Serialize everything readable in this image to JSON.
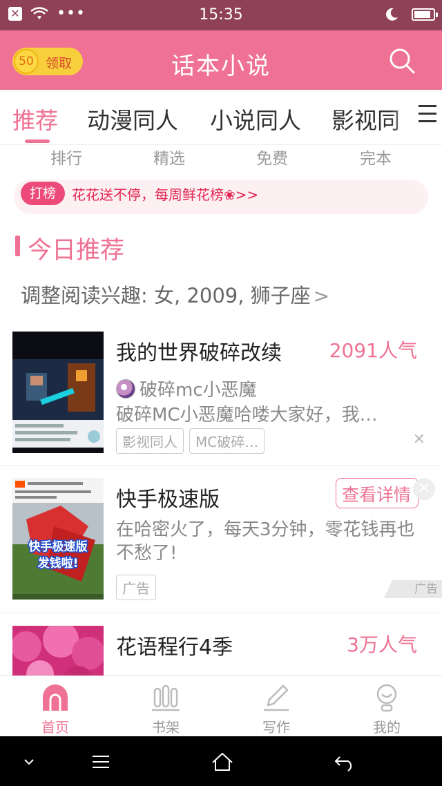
{
  "status_bar": {
    "time": "15:35",
    "battery_level": 0.9
  },
  "header": {
    "coin_value": "50",
    "claim_label": "领取",
    "title": "话本小说"
  },
  "category_tabs": [
    "推荐",
    "动漫同人",
    "小说同人",
    "影视同"
  ],
  "sub_tabs": [
    "排行",
    "精选",
    "免费",
    "完本"
  ],
  "banner": {
    "badge": "打榜",
    "text": "花花送不停，每周鲜花榜❀>>"
  },
  "section": {
    "title": "今日推荐",
    "interest": "调整阅读兴趣: 女, 2009, 狮子座",
    "chevron": ">"
  },
  "feed": [
    {
      "title": "我的世界破碎改续",
      "popularity": "2091人气",
      "author": "破碎mc小恶魔",
      "desc": "破碎MC小恶魔哈喽大家好，我…",
      "tags": [
        "影视同人",
        "MC破碎…"
      ],
      "close": "✕"
    },
    {
      "title": "快手极速版",
      "detail_button": "查看详情",
      "desc": "在哈密火了，每天3分钟，零花钱再也不愁了!",
      "tag": "广告",
      "ad_mark": "广告",
      "thumb_caption": "快手极速版\n发钱啦!"
    },
    {
      "title": "花语程行4季",
      "popularity": "3万人气"
    }
  ],
  "bottom_nav": [
    {
      "label": "首页",
      "icon": "home-icon",
      "active": true
    },
    {
      "label": "书架",
      "icon": "bookshelf-icon",
      "active": false
    },
    {
      "label": "写作",
      "icon": "pencil-icon",
      "active": false
    },
    {
      "label": "我的",
      "icon": "profile-icon",
      "active": false
    }
  ],
  "colors": {
    "accent": "#ef7193",
    "status_bar": "#8f4158",
    "banner_text": "#e2244f"
  }
}
